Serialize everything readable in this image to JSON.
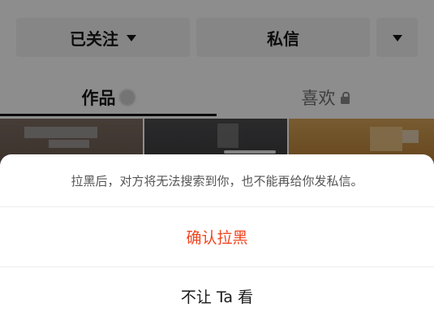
{
  "profile": {
    "follow_button_label": "已关注",
    "message_button_label": "私信",
    "tabs": {
      "works": "作品",
      "likes": "喜欢"
    }
  },
  "sheet": {
    "description": "拉黑后，对方将无法搜索到你，也不能再给你发私信。",
    "confirm_block_label": "确认拉黑",
    "hide_from_label": "不让 Ta 看"
  },
  "colors": {
    "danger": "#f2451f",
    "overlay": "rgba(0,0,0,0.44)"
  }
}
